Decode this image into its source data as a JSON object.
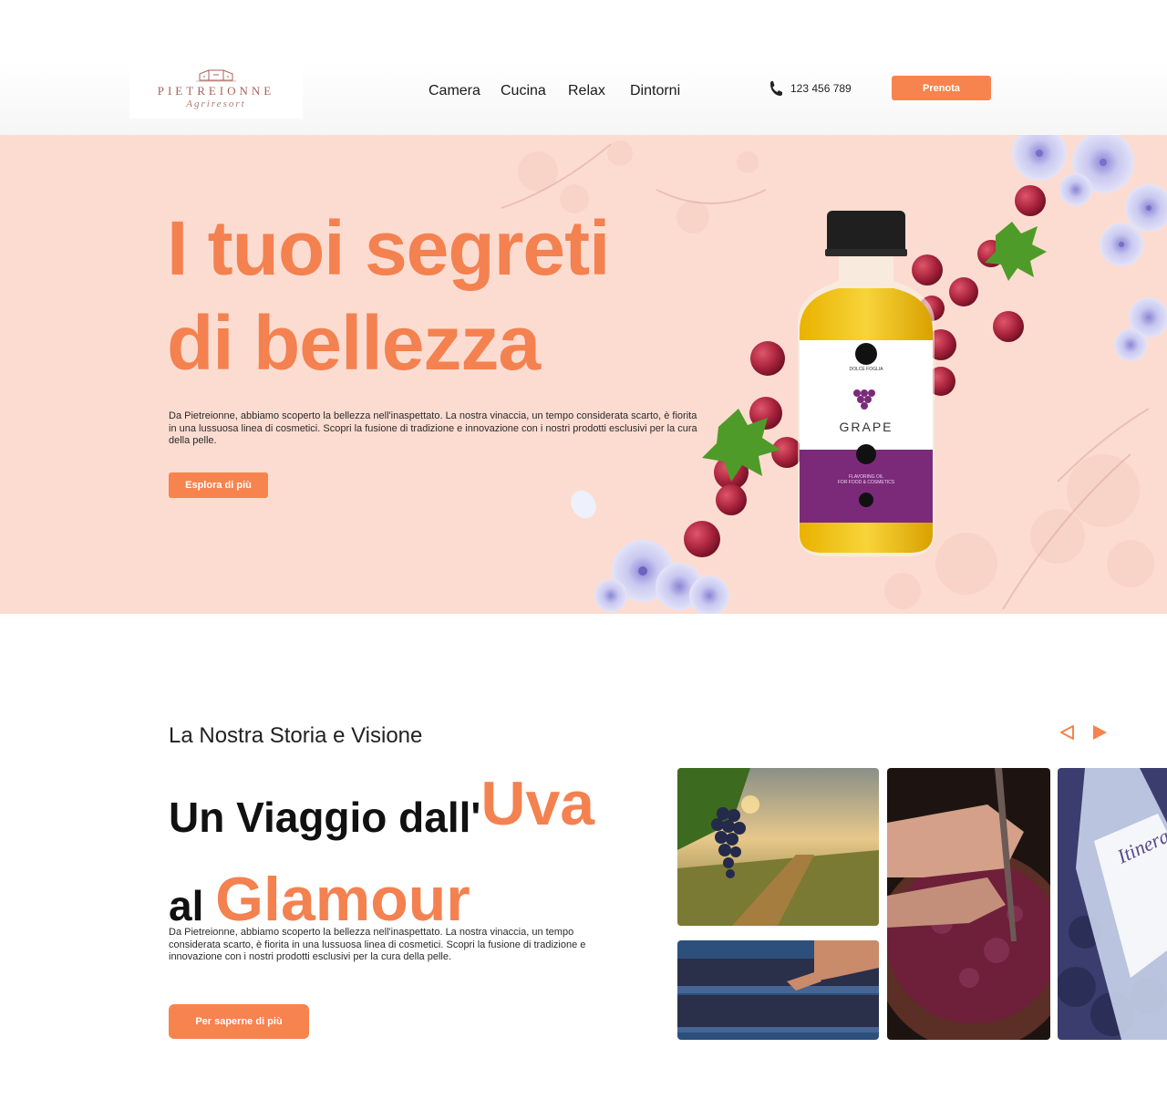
{
  "header": {
    "logo": {
      "name": "PIETREIONNE",
      "sub": "Agriresort"
    },
    "nav": [
      {
        "label": "Camera"
      },
      {
        "label": "Cucina"
      },
      {
        "label": "Relax"
      },
      {
        "label": "Dintorni"
      }
    ],
    "phone": "123 456 789",
    "cta_label": "Prenota"
  },
  "hero": {
    "title_line1": "I tuoi segreti",
    "title_line2": "di bellezza",
    "description": "Da Pietreionne, abbiamo scoperto la bellezza nell'inaspettato. La nostra vinaccia, un tempo considerata scarto, è fiorita in una lussuosa linea di cosmetici. Scopri la fusione di tradizione e innovazione con i nostri prodotti esclusivi per la cura della pelle.",
    "cta_label": "Esplora di più",
    "product": {
      "brand": "DOLCE FOGLIA",
      "name": "GRAPE",
      "tagline_1": "FLAVORING OIL",
      "tagline_2": "FOR FOOD & COSMETICS"
    }
  },
  "story": {
    "kicker": "La Nostra Storia e Visione",
    "title_part1": "Un Viaggio dall'",
    "title_highlight1": "Uva",
    "title_part2": "al ",
    "title_highlight2": "Glamour",
    "description": "Da Pietreionne, abbiamo scoperto la bellezza nell'inaspettato. La nostra vinaccia, un tempo considerata scarto, è fiorita in una lussuosa linea di cosmetici. Scopri la fusione di tradizione e innovazione con i nostri prodotti esclusivi per la cura della pelle.",
    "cta_label": "Per saperne di più",
    "gallery_bottle_label": "Itinera"
  },
  "colors": {
    "accent": "#f7834f",
    "hero_bg": "#fcdcd1",
    "headline_orange": "#f48150"
  },
  "icons": {
    "phone": "phone-icon",
    "prev": "arrow-left-icon",
    "next": "arrow-right-icon"
  }
}
